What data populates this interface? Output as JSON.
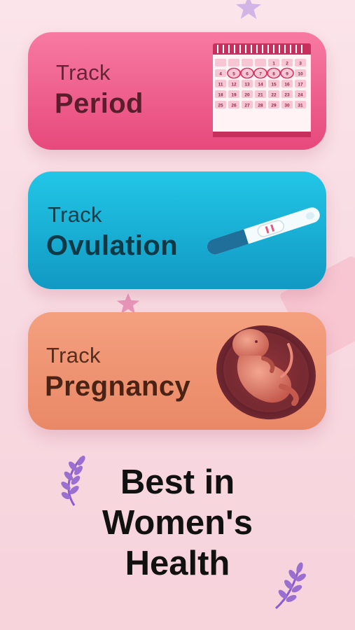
{
  "cards": {
    "period": {
      "track": "Track",
      "title": "Period"
    },
    "ovulation": {
      "track": "Track",
      "title": "Ovulation"
    },
    "pregnancy": {
      "track": "Track",
      "title": "Pregnancy"
    }
  },
  "calendar": {
    "days": [
      "",
      "",
      "",
      "",
      "1",
      "2",
      "3",
      "4",
      "5",
      "6",
      "7",
      "8",
      "9",
      "10",
      "11",
      "12",
      "13",
      "14",
      "15",
      "16",
      "17",
      "18",
      "19",
      "20",
      "21",
      "22",
      "23",
      "24",
      "25",
      "26",
      "27",
      "28",
      "29",
      "30",
      "31"
    ]
  },
  "headline": {
    "line1": "Best in",
    "line2": "Women's",
    "line3": "Health"
  },
  "colors": {
    "period": "#e7497d",
    "ovulation": "#1199c3",
    "pregnancy": "#e98866",
    "accent_purple": "#9a6fd0"
  },
  "icons": [
    "star-icon",
    "calendar-icon",
    "pregnancy-test-icon",
    "fetus-womb-icon",
    "laurel-icon"
  ]
}
